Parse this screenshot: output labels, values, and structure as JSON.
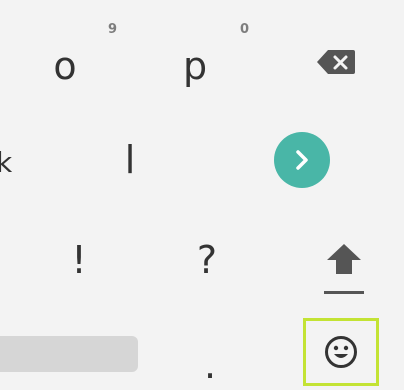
{
  "keyboard": {
    "rows": [
      {
        "keys": [
          {
            "label": "o",
            "hint": "9"
          },
          {
            "label": "p",
            "hint": "0"
          },
          {
            "icon": "backspace-icon"
          }
        ]
      },
      {
        "keys": [
          {
            "label": "l"
          },
          {
            "icon": "go-arrow-icon",
            "color": "#49b6a7"
          }
        ]
      },
      {
        "keys": [
          {
            "label": "!"
          },
          {
            "label": "?"
          },
          {
            "icon": "shift-icon"
          }
        ]
      },
      {
        "keys": [
          {
            "label": "",
            "role": "space"
          },
          {
            "label": "."
          },
          {
            "icon": "emoji-icon",
            "highlight_color": "#c3e334"
          }
        ]
      }
    ],
    "left_edge_partial": "k"
  }
}
